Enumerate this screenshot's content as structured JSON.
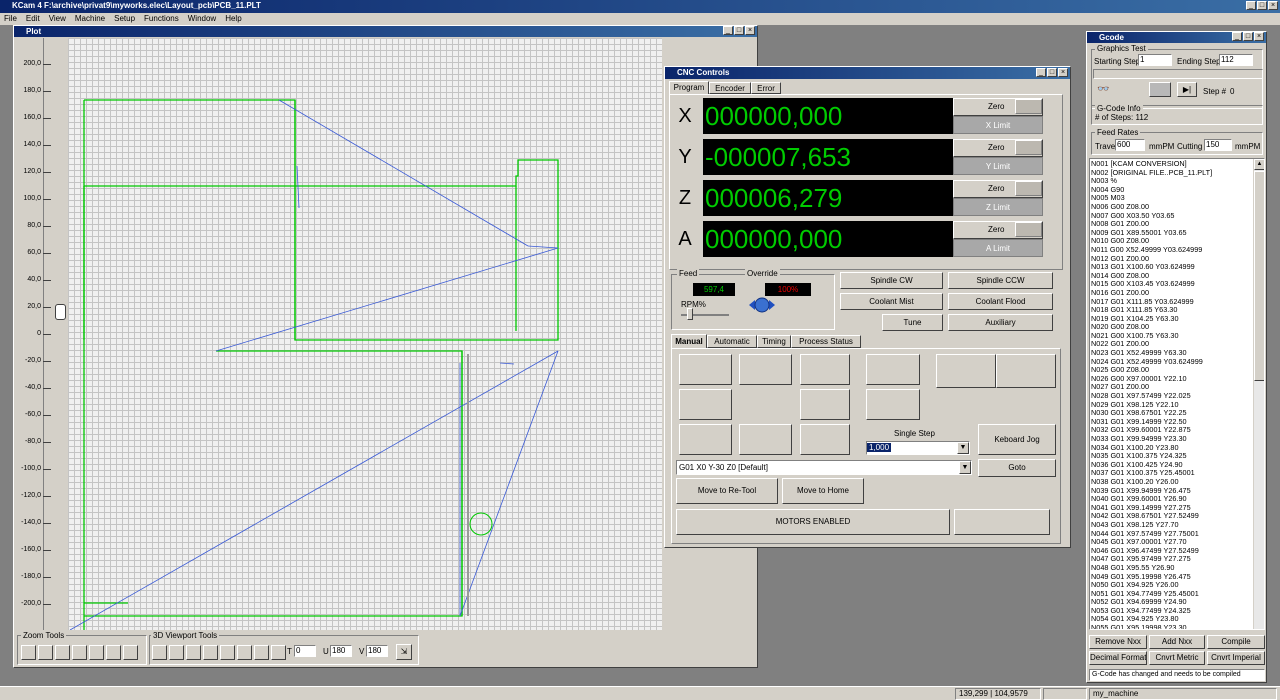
{
  "app": {
    "title": "KCam 4 F:\\archive\\privat9\\myworks.elec\\Layout_pcb\\PCB_11.PLT",
    "menu": [
      "File",
      "Edit",
      "View",
      "Machine",
      "Setup",
      "Functions",
      "Window",
      "Help"
    ]
  },
  "plot": {
    "title": "Plot",
    "yticks": [
      "200,0",
      "180,0",
      "160,0",
      "140,0",
      "120,0",
      "100,0",
      "80,0",
      "60,0",
      "40,0",
      "20,0",
      "0",
      "-20,0",
      "-40,0",
      "-60,0",
      "-80,0",
      "-100,0",
      "-120,0",
      "-140,0",
      "-160,0",
      "-180,0",
      "-200,0"
    ],
    "zoom_tools_label": "Zoom Tools",
    "viewport_tools_label": "3D Viewport Tools",
    "t_label": "T",
    "t_value": "0",
    "u_label": "U",
    "u_value": "180",
    "v_label": "V",
    "v_value": "180"
  },
  "cnc": {
    "title": "CNC Controls",
    "tabs": [
      "Program",
      "Encoder",
      "Error"
    ],
    "axes": [
      {
        "label": "X",
        "value": "000000,000",
        "zero": "Zero",
        "limit": "X Limit"
      },
      {
        "label": "Y",
        "value": "-000007,653",
        "zero": "Zero",
        "limit": "Y Limit"
      },
      {
        "label": "Z",
        "value": "000006,279",
        "zero": "Zero",
        "limit": "Z Limit"
      },
      {
        "label": "A",
        "value": "000000,000",
        "zero": "Zero",
        "limit": "A Limit"
      }
    ],
    "feed_label": "Feed",
    "feed_value": "597,4",
    "override_label": "Override",
    "override_value": "100%",
    "rpm_label": "RPM%",
    "spindle_cw": "Spindle CW",
    "spindle_ccw": "Spindle CCW",
    "coolant_mist": "Coolant Mist",
    "coolant_flood": "Coolant Flood",
    "tune": "Tune",
    "auxiliary": "Auxiliary",
    "mode_tabs": [
      "Manual",
      "Automatic",
      "Timing",
      "Process Status"
    ],
    "single_step_label": "Single Step",
    "single_step_value": "1,000",
    "keyboard_jog": "Keboard Jog",
    "command_value": "G01 X0 Y-30 Z0 [Default]",
    "goto": "Goto",
    "move_retool": "Move to Re-Tool",
    "move_home": "Move to Home",
    "motors": "MOTORS ENABLED"
  },
  "gcode": {
    "title": "Gcode",
    "graphics_test_label": "Graphics Test",
    "starting_step_label": "Starting Step",
    "starting_step": "1",
    "ending_step_label": "Ending Step",
    "ending_step": "112",
    "step_label": "Step #",
    "step_value": "0",
    "info_label": "G-Code Info",
    "num_steps": "# of Steps:  112",
    "feed_rates_label": "Feed Rates",
    "travel_label": "Travel",
    "travel_value": "600",
    "travel_unit": "mmPM",
    "cutting_label": "Cutting",
    "cutting_value": "150",
    "cutting_unit": "mmPM",
    "lines": [
      "N001 [KCAM CONVERSION]",
      "N002 [ORIGINAL FILE..PCB_11.PLT]",
      "N003 %",
      "N004 G90",
      "N005 M03",
      "N006 G00 Z08.00",
      "N007 G00 X03.50 Y03.65",
      "N008 G01 Z00.00",
      "N009 G01 X89.55001 Y03.65",
      "N010 G00 Z08.00",
      "N011 G00 X52.49999 Y03.624999",
      "N012 G01 Z00.00",
      "N013 G01 X100.60 Y03.624999",
      "N014 G00 Z08.00",
      "N015 G00 X103.45 Y03.624999",
      "N016 G01 Z00.00",
      "N017 G01 X111.85 Y03.624999",
      "N018 G01 X111.85 Y63.30",
      "N019 G01 X104.25 Y63.30",
      "N020 G00 Z08.00",
      "N021 G00 X100.75 Y63.30",
      "N022 G01 Z00.00",
      "N023 G01 X52.49999 Y63.30",
      "N024 G01 X52.49999 Y03.624999",
      "N025 G00 Z08.00",
      "N026 G00 X97.00001 Y22.10",
      "N027 G01 Z00.00",
      "N028 G01 X97.57499 Y22.025",
      "N029 G01 X98.125 Y22.10",
      "N030 G01 X98.67501 Y22.25",
      "N031 G01 X99.14999 Y22.50",
      "N032 G01 X99.60001 Y22.875",
      "N033 G01 X99.94999 Y23.30",
      "N034 G01 X100.20 Y23.80",
      "N035 G01 X100.375 Y24.325",
      "N036 G01 X100.425 Y24.90",
      "N037 G01 X100.375 Y25.45001",
      "N038 G01 X100.20 Y26.00",
      "N039 G01 X99.94999 Y26.475",
      "N040 G01 X99.60001 Y26.90",
      "N041 G01 X99.14999 Y27.275",
      "N042 G01 X98.67501 Y27.52499",
      "N043 G01 X98.125 Y27.70",
      "N044 G01 X97.57499 Y27.75001",
      "N045 G01 X97.00001 Y27.70",
      "N046 G01 X96.47499 Y27.52499",
      "N047 G01 X95.97499 Y27.275",
      "N048 G01 X95.55 Y26.90",
      "N049 G01 X95.19998 Y26.475",
      "N050 G01 X94.925 Y26.00",
      "N051 G01 X94.77499 Y25.45001",
      "N052 G01 X94.69999 Y24.90",
      "N053 G01 X94.77499 Y24.325",
      "N054 G01 X94.925 Y23.80",
      "N055 G01 X95.19998 Y23.30"
    ],
    "remove_nxx": "Remove  Nxx",
    "add_nxx": "Add Nxx",
    "compile": "Compile",
    "decimal_format": "Decimal Format",
    "cnvrt_metric": "Cnvrt Metric",
    "cnvrt_imperial": "Cnvrt Imperial",
    "status_msg": "G-Code has changed and needs to be compiled"
  },
  "status": {
    "coords": "139,299 | 104,9579",
    "machine": "my_machine"
  }
}
